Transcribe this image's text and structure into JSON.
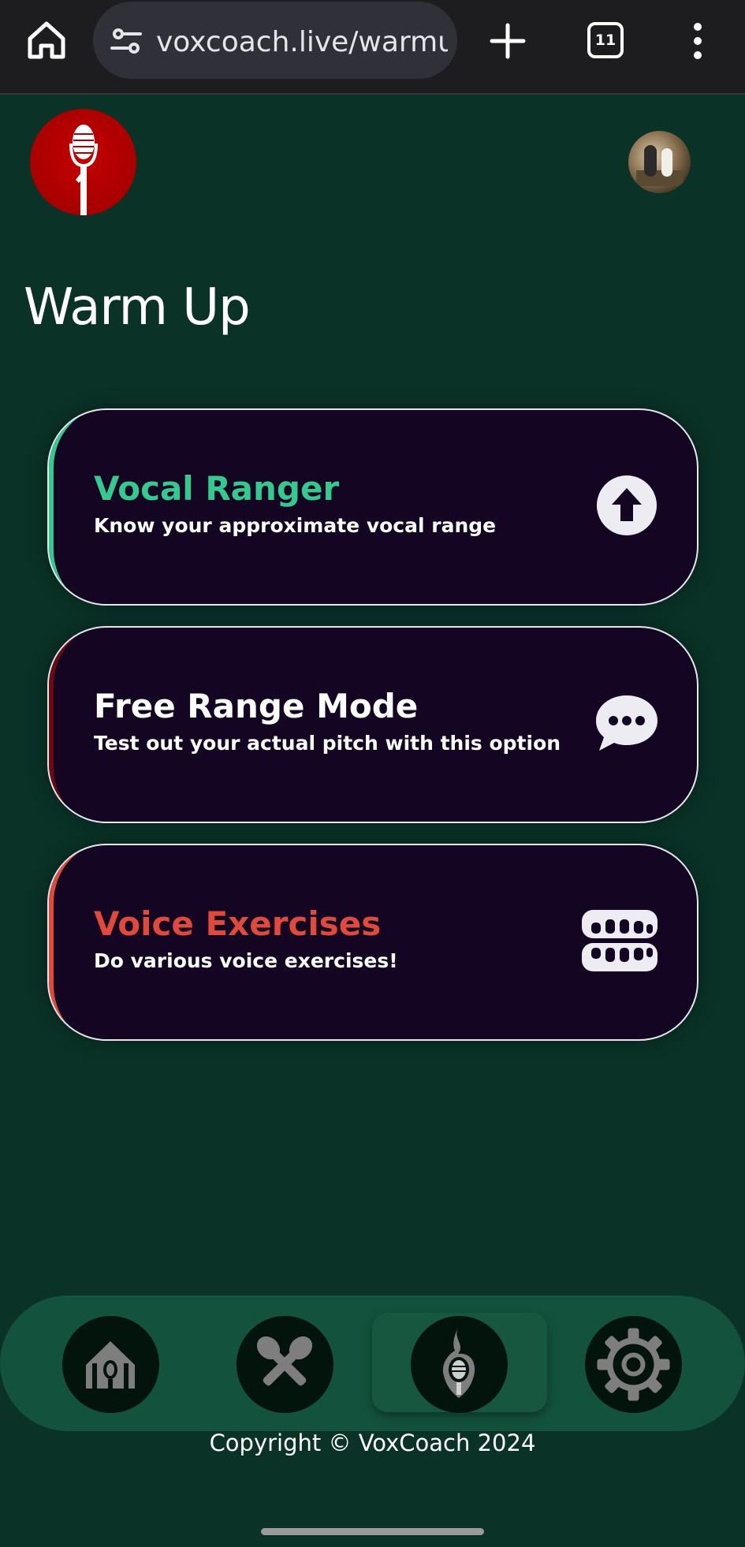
{
  "browser": {
    "url": "voxcoach.live/warmup",
    "tab_count": "11",
    "icons": [
      "home-icon",
      "site-settings-icon",
      "plus-icon",
      "tab-switcher-icon",
      "more-vertical-icon"
    ]
  },
  "header": {
    "logo_icon": "microphone-logo",
    "avatar_icon": "user-avatar"
  },
  "page": {
    "title": "Warm Up"
  },
  "cards": [
    {
      "title": "Vocal Ranger",
      "subtitle": "Know your approximate vocal range",
      "title_color": "#35c98f",
      "accent_color": "#35c98f",
      "icon": "arrow-up-circle-icon"
    },
    {
      "title": "Free Range Mode",
      "subtitle": "Test out your actual pitch with this option",
      "title_color": "#ffffff",
      "accent_color": "#6a0a12",
      "icon": "speech-bubble-icon"
    },
    {
      "title": "Voice Exercises",
      "subtitle": "Do various voice exercises!",
      "title_color": "#e04a3c",
      "accent_color": "#e04a3c",
      "icon": "teeth-icon"
    }
  ],
  "bottom_nav": {
    "items": [
      {
        "name": "home",
        "icon": "home-mic-icon",
        "active": false
      },
      {
        "name": "tools",
        "icon": "crossed-mics-icon",
        "active": false
      },
      {
        "name": "warmup",
        "icon": "flame-mic-icon",
        "active": true
      },
      {
        "name": "settings",
        "icon": "gear-icon",
        "active": false
      }
    ]
  },
  "footer": {
    "copyright": "Copyright © VoxCoach 2024"
  },
  "colors": {
    "background": "#0a3226",
    "card_bg": "#140522",
    "nav_bg": "#13533d",
    "browser_bar": "#1d1d1f"
  }
}
